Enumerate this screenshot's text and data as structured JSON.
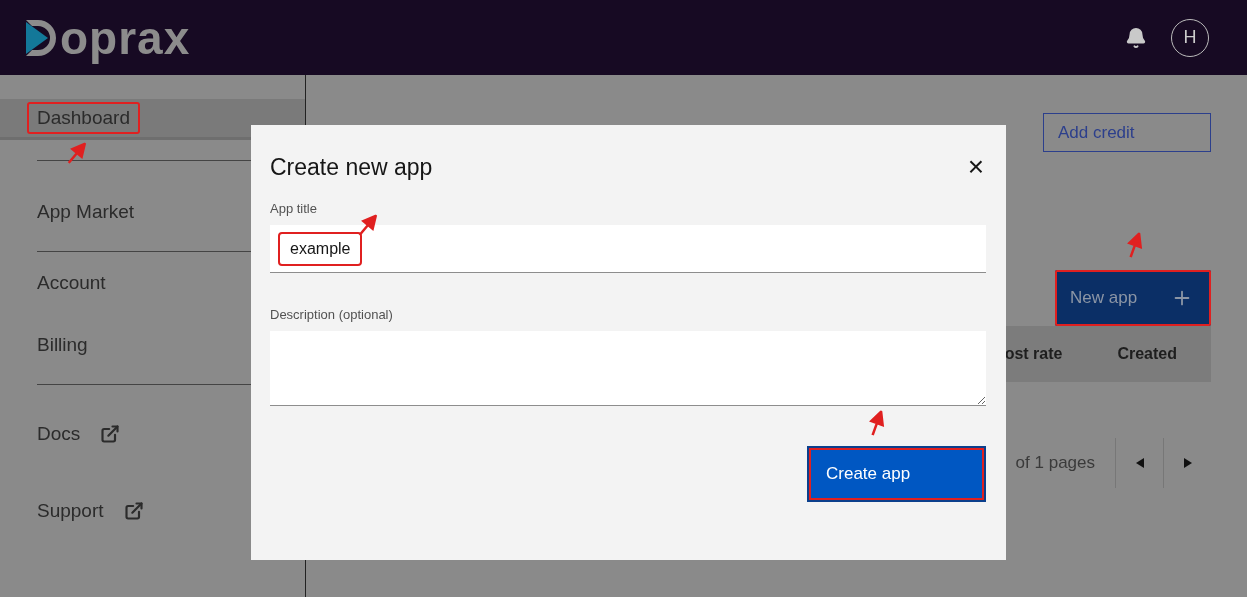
{
  "header": {
    "logo": "oprax",
    "avatar": "H"
  },
  "sidebar": {
    "groups": [
      [
        {
          "label": "Dashboard",
          "selected": true,
          "external": false,
          "highlighted": true
        }
      ],
      [
        {
          "label": "App Market",
          "selected": false,
          "external": false,
          "highlighted": false
        }
      ],
      [
        {
          "label": "Account",
          "selected": false,
          "external": false,
          "highlighted": false
        },
        {
          "label": "Billing",
          "selected": false,
          "external": false,
          "highlighted": false
        }
      ],
      [
        {
          "label": "Docs",
          "selected": false,
          "external": true,
          "highlighted": false
        },
        {
          "label": "Support",
          "selected": false,
          "external": true,
          "highlighted": false
        }
      ]
    ]
  },
  "main": {
    "add_credit": "Add credit",
    "new_app": {
      "label": "New app",
      "highlighted": true
    },
    "table": {
      "columns": [
        "ost rate",
        "Created"
      ]
    },
    "pagination": {
      "text": "of 1 pages"
    }
  },
  "modal": {
    "title": "Create new app",
    "close": "×",
    "fields": [
      {
        "kind": "input",
        "label": "App title",
        "value": "example",
        "highlighted": true
      },
      {
        "kind": "textarea",
        "label": "Description (optional)"
      }
    ],
    "submit": {
      "label": "Create app",
      "highlighted": true
    }
  }
}
